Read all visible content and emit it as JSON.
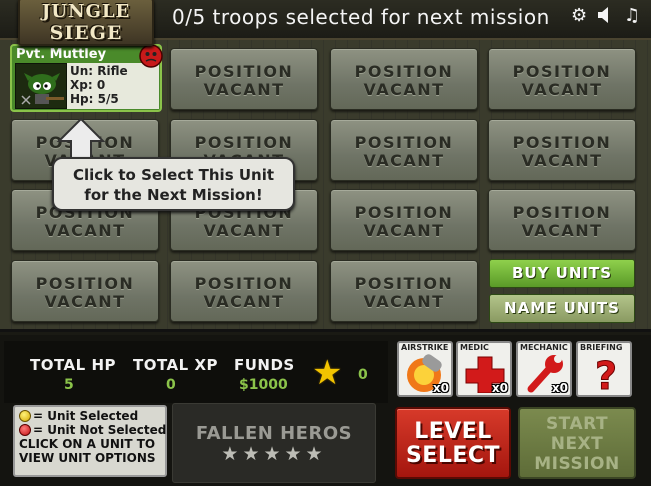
{
  "logo": {
    "line1": "JUNGLE",
    "line2": "SIEGE"
  },
  "header": {
    "troops_status": "0/5 troops selected for next mission",
    "icons": [
      "gear-icon",
      "speaker-icon",
      "music-icon"
    ]
  },
  "unit": {
    "name": "Pvt. Muttley",
    "unit_type": "Un: Rifle",
    "xp": "Xp: 0",
    "hp": "Hp: 5/5",
    "selected": false
  },
  "slots": {
    "line1": "POSITION",
    "line2": "VACANT"
  },
  "tooltip": {
    "line1": "Click to Select This Unit",
    "line2": "for the Next Mission!"
  },
  "buttons": {
    "buy_units": "BUY UNITS",
    "name_units": "NAME UNITS"
  },
  "stats": {
    "total_hp_label": "TOTAL HP",
    "total_hp": "5",
    "total_xp_label": "TOTAL XP",
    "total_xp": "0",
    "funds_label": "FUNDS",
    "funds": "$1000",
    "stars": "0"
  },
  "legend": {
    "selected": "= Unit Selected",
    "not_selected": "= Unit Not Selected",
    "hint_line1": "CLICK ON A UNIT TO",
    "hint_line2": "VIEW UNIT OPTIONS"
  },
  "fallen": {
    "title": "FALLEN HEROS",
    "stars": "★★★★★"
  },
  "support": [
    {
      "label": "AIRSTRIKE",
      "count": "x0"
    },
    {
      "label": "MEDIC",
      "count": "x0"
    },
    {
      "label": "MECHANIC",
      "count": "x0"
    },
    {
      "label": "BRIEFING",
      "count": ""
    }
  ],
  "level_select": {
    "line1": "LEVEL",
    "line2": "SELECT"
  },
  "start_mission": {
    "line1": "START",
    "line2": "NEXT",
    "line3": "MISSION"
  },
  "colors": {
    "accent_green": "#8bc34a",
    "level_red": "#c0281a",
    "card_green": "#4a8a2a"
  }
}
